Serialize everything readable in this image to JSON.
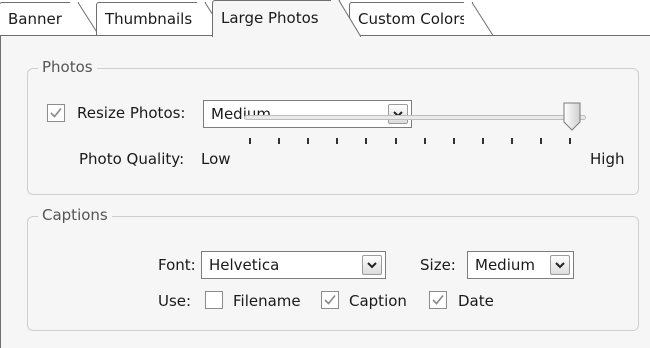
{
  "tabs": [
    {
      "label": "Banner",
      "active": false
    },
    {
      "label": "Thumbnails",
      "active": false
    },
    {
      "label": "Large Photos",
      "active": true
    },
    {
      "label": "Custom Colors",
      "active": false
    }
  ],
  "photos": {
    "legend": "Photos",
    "resize_checked": true,
    "resize_label": "Resize Photos:",
    "resize_value": "Medium",
    "quality_label": "Photo Quality:",
    "quality_low": "Low",
    "quality_high": "High",
    "quality_level": 0.96
  },
  "captions": {
    "legend": "Captions",
    "font_label": "Font:",
    "font_value": "Helvetica",
    "size_label": "Size:",
    "size_value": "Medium",
    "use_label": "Use:",
    "options": [
      {
        "label": "Filename",
        "checked": false
      },
      {
        "label": "Caption",
        "checked": true
      },
      {
        "label": "Date",
        "checked": true
      }
    ]
  },
  "colors": {
    "border": "#6e6e6e",
    "panel": "#f6f6f6",
    "check": "#8a8a8a"
  }
}
